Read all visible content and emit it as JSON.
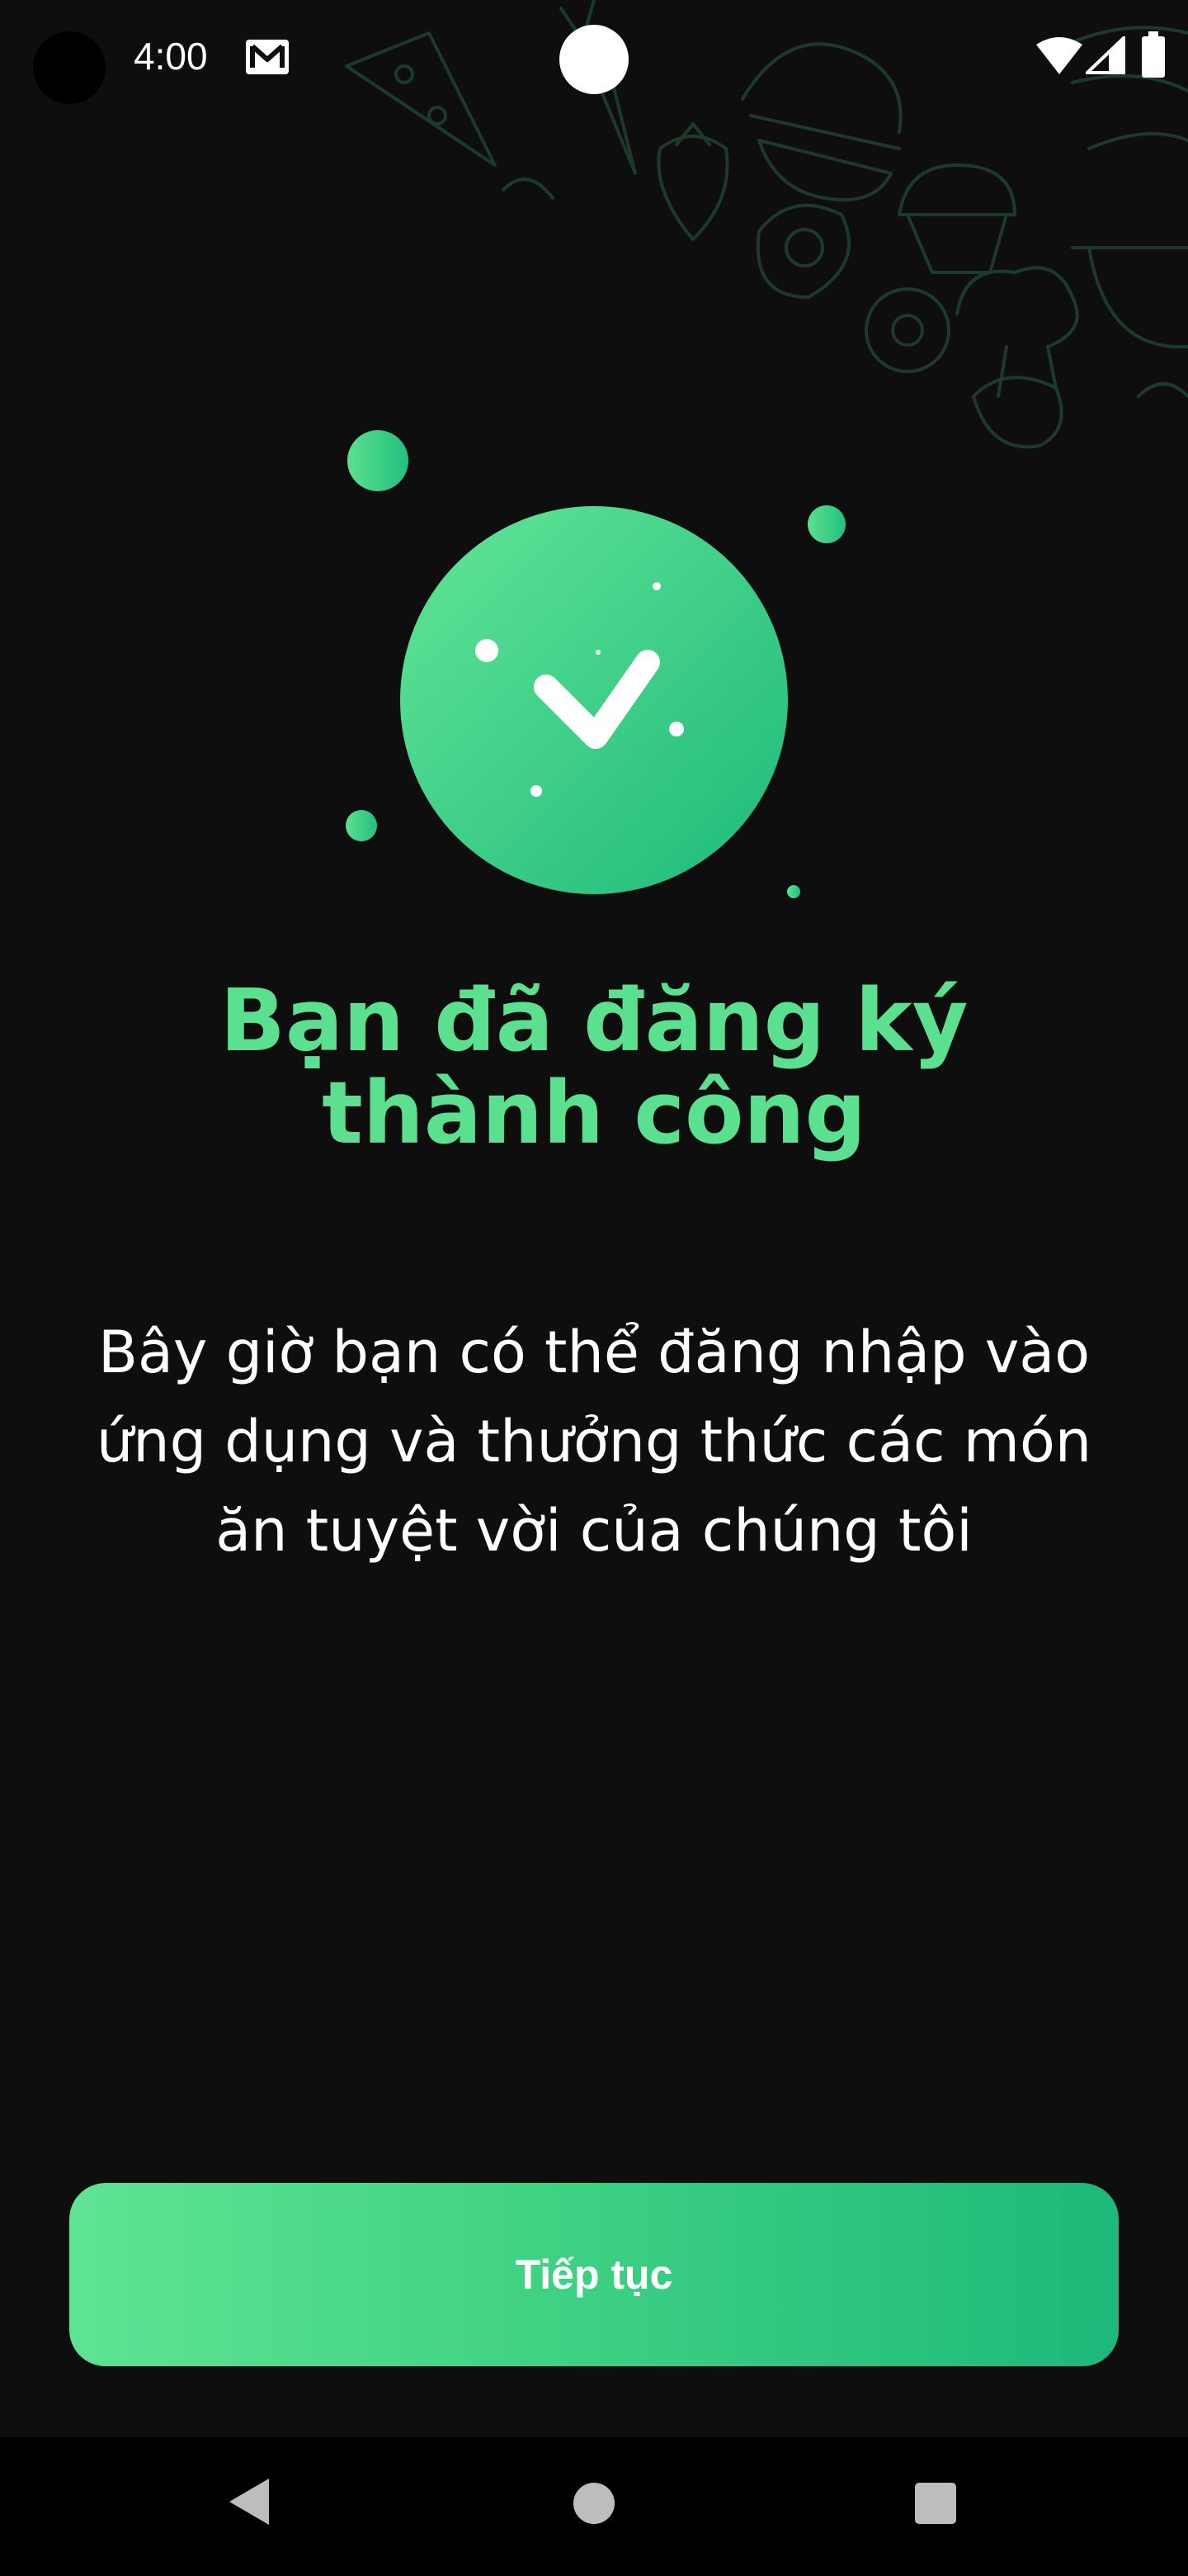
{
  "status_bar": {
    "time": "4:00",
    "notification_icon": "gmail-icon",
    "icons": [
      "wifi-icon",
      "cellular-signal-icon",
      "battery-icon"
    ]
  },
  "illustration": {
    "icon": "check-icon"
  },
  "headline": {
    "line1": "Bạn đã đăng ký",
    "line2": "thành công"
  },
  "message": {
    "line1": "Bây giờ bạn có thể đăng nhập vào",
    "line2": "ứng dụng và thưởng thức các món",
    "line3": "ăn tuyệt vời của chúng tôi"
  },
  "actions": {
    "continue_label": "Tiếp tục"
  },
  "nav_bar": {
    "icons": [
      "back-icon",
      "home-icon",
      "recents-icon"
    ]
  },
  "colors": {
    "background": "#0e0e0e",
    "accent": "#5be08f",
    "accent_dark": "#1eb87a",
    "text": "#ffffff"
  }
}
